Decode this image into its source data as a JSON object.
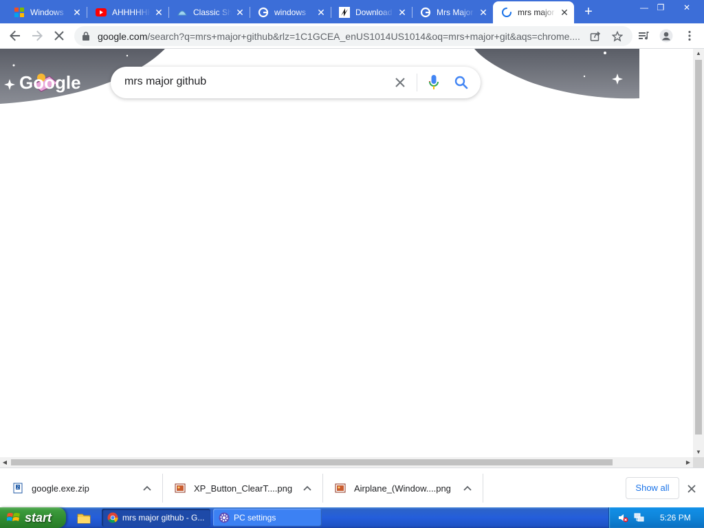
{
  "window": {
    "controls": {
      "minimize": "—",
      "restore": "❐",
      "close": "✕"
    }
  },
  "tabs": [
    {
      "title": "Windows",
      "icon": "windows-logo-icon",
      "active": false
    },
    {
      "title": "AHHHHHH",
      "icon": "youtube-icon",
      "active": false
    },
    {
      "title": "Classic Shell",
      "icon": "classic-shell-icon",
      "active": false
    },
    {
      "title": "windows",
      "icon": "google-icon",
      "active": false
    },
    {
      "title": "Download",
      "icon": "download-site-icon",
      "active": false
    },
    {
      "title": "Mrs Major",
      "icon": "google-icon",
      "active": false
    },
    {
      "title": "mrs major",
      "icon": "loading-spinner-icon",
      "active": true
    }
  ],
  "toolbar": {
    "url_host": "google.com",
    "url_rest": "/search?q=mrs+major+github&rlz=1C1GCEA_enUS1014US1014&oq=mrs+major+git&aqs=chrome....",
    "icons": [
      "back-icon",
      "forward-icon",
      "stop-loading-icon",
      "lock-icon",
      "share-icon",
      "bookmark-star-icon",
      "media-controls-icon",
      "profile-icon",
      "menu-icon"
    ]
  },
  "search": {
    "logo_text": "Google",
    "query": "mrs major github"
  },
  "downloads": [
    {
      "name": "google.exe.zip",
      "icon": "zip-file-icon"
    },
    {
      "name": "XP_Button_ClearT....png",
      "icon": "image-file-icon"
    },
    {
      "name": "Airplane_(Window....png",
      "icon": "image-file-icon"
    }
  ],
  "shelf": {
    "show_all": "Show all"
  },
  "taskbar": {
    "start_label": "start",
    "tasks": [
      {
        "label": "mrs major github - G...",
        "icon": "chrome-icon",
        "active": true
      },
      {
        "label": "PC settings",
        "icon": "gear-icon",
        "active": false
      }
    ],
    "clock": "5:26 PM"
  },
  "colors": {
    "tabstrip": "#3c6ed8",
    "taskbar": "#245edb",
    "start_button": "#3c9a3c",
    "tray": "#0f84d8",
    "link_blue": "#1a73e8"
  }
}
